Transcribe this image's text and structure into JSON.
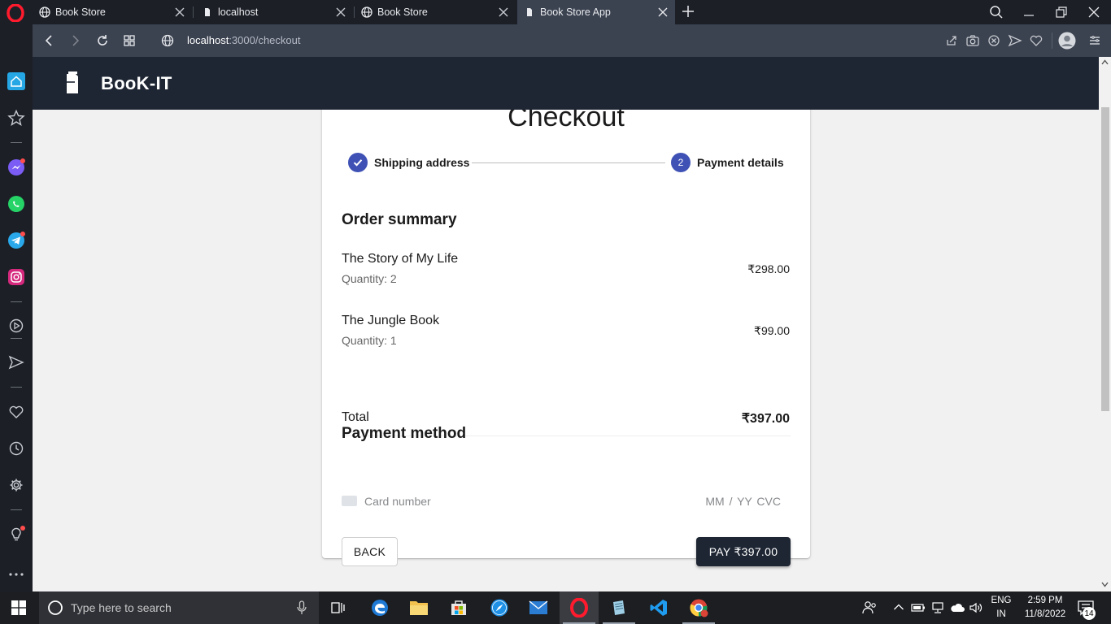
{
  "browser": {
    "tabs": [
      {
        "title": "Book Store",
        "active": false
      },
      {
        "title": "localhost",
        "active": false
      },
      {
        "title": "Book Store",
        "active": false
      },
      {
        "title": "Book Store App",
        "active": true
      }
    ],
    "url_host": "localhost",
    "url_path": ":3000/checkout"
  },
  "app": {
    "brand": "BooK-IT"
  },
  "checkout": {
    "title": "Checkout",
    "steps": [
      {
        "label": "Shipping address",
        "state": "completed"
      },
      {
        "label": "Payment details",
        "number": "2",
        "state": "active"
      }
    ],
    "order_summary_title": "Order summary",
    "items": [
      {
        "name": "The Story of My Life",
        "quantity": "Quantity: 2",
        "price": "₹298.00"
      },
      {
        "name": "The Jungle Book",
        "quantity": "Quantity: 1",
        "price": "₹99.00"
      }
    ],
    "total_label": "Total",
    "total_value": "₹397.00",
    "payment_method_title": "Payment method",
    "card_number_placeholder": "Card number",
    "expiry_cvc_placeholder": "MM / YY  CVC",
    "back_label": "BACK",
    "pay_label": "PAY ₹397.00"
  },
  "taskbar": {
    "search_placeholder": "Type here to search",
    "language": "ENG",
    "region": "IN",
    "time": "2:59 PM",
    "date": "11/8/2022",
    "notification_count": "14"
  },
  "colors": {
    "appbar": "#1e2633",
    "step_accent": "#3f51b5",
    "browser_chrome": "#1c1f26",
    "address_bar": "#3b4250"
  }
}
